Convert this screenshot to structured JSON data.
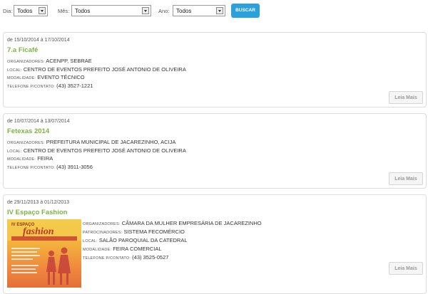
{
  "filters": {
    "dia_label": "Dia:",
    "dia_value": "Todos",
    "mes_label": "Mês:",
    "mes_value": "Todos",
    "ano_label": "Ano:",
    "ano_value": "Todos",
    "search_button": "BUSCAR"
  },
  "events": [
    {
      "date": "de 15/10/2014 à 17/10/2014",
      "title": "7.a Ficafé",
      "organizadores_label": "ORGANIZADORES:",
      "organizadores": "ACENPP, SEBRAE",
      "local_label": "LOCAL:",
      "local": "CENTRO DE EVENTOS PREFEITO JOSÉ ANTONIO DE OLIVEIRA",
      "modalidade_label": "MODALIDADE:",
      "modalidade": "EVENTO TÉCNICO",
      "telefone_label": "TELEFONE P/CONTATO:",
      "telefone": "(43) 3527-1221",
      "more": "Leia Mais"
    },
    {
      "date": "de 10/07/2014 à 13/07/2014",
      "title": "Fetexas 2014",
      "organizadores_label": "ORGANIZADORES:",
      "organizadores": "PREFEITURA MUNICIPAL DE JACAREZINHO, ACIJA",
      "local_label": "LOCAL:",
      "local": "CENTRO DE EVENTOS PREFEITO JOSÉ ANTONIO DE OLIVEIRA",
      "modalidade_label": "MODALIDADE:",
      "modalidade": "FEIRA",
      "telefone_label": "TELEFONE P/CONTATO:",
      "telefone": "(43) 3911-3056",
      "more": "Leia Mais"
    },
    {
      "date": "de 29/11/2013 à 01/12/2013",
      "title": "IV Espaço Fashion",
      "organizadores_label": "ORGANIZADORES:",
      "organizadores": "CÂMARA DA MULHER EMPRESÁRIA DE JACAREZINHO",
      "patrocinadores_label": "PATROCINADORES:",
      "patrocinadores": "SISTEMA FECOMÉRCIO",
      "local_label": "LOCAL:",
      "local": "SALÃO PAROQUIAL DA CATEDRAL",
      "modalidade_label": "MODALIDADE:",
      "modalidade": "FEIRA COMERCIAL",
      "telefone_label": "TELEFONE P/CONTATO:",
      "telefone": "(43) 3525-0527",
      "more": "Leia Mais",
      "poster": {
        "line1": "IV ESPAÇO",
        "line2": "fashion"
      }
    }
  ]
}
